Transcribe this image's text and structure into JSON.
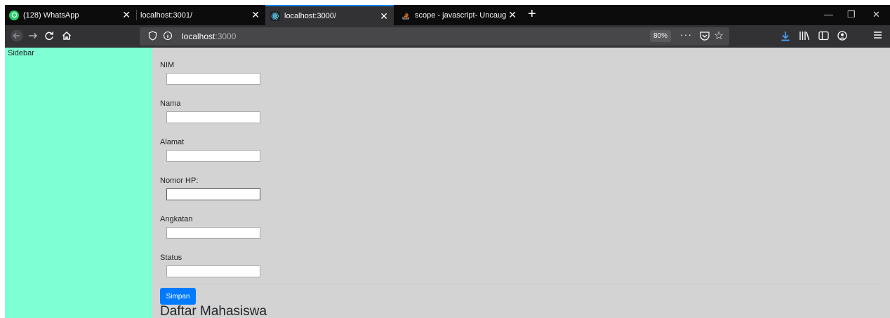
{
  "browser": {
    "tabs": [
      {
        "title": "(128) WhatsApp",
        "selected": false,
        "favicon": "whatsapp-icon"
      },
      {
        "title": "localhost:3001/",
        "selected": false,
        "favicon": ""
      },
      {
        "title": "localhost:3000/",
        "selected": true,
        "favicon": "react-icon"
      },
      {
        "title": "scope - javascript- Uncaught Sy",
        "selected": false,
        "favicon": "stackoverflow-icon"
      }
    ],
    "url_host": "localhost",
    "url_port": ":3000",
    "zoom": "80%",
    "colors": {
      "tab_strip": "#0c0c0d",
      "toolbar": "#323234",
      "accent": "#0a84ff"
    }
  },
  "sidebar": {
    "label": "Sidebar",
    "color": "#7fffd4"
  },
  "form": {
    "fields": [
      {
        "label": "NIM",
        "value": ""
      },
      {
        "label": "Nama",
        "value": ""
      },
      {
        "label": "Alamat",
        "value": ""
      },
      {
        "label": "Nomor HP:",
        "value": ""
      },
      {
        "label": "Angkatan",
        "value": ""
      },
      {
        "label": "Status",
        "value": ""
      }
    ],
    "submit_label": "Simpan",
    "button_color": "#007bff"
  },
  "list": {
    "heading": "Daftar Mahasiswa"
  }
}
